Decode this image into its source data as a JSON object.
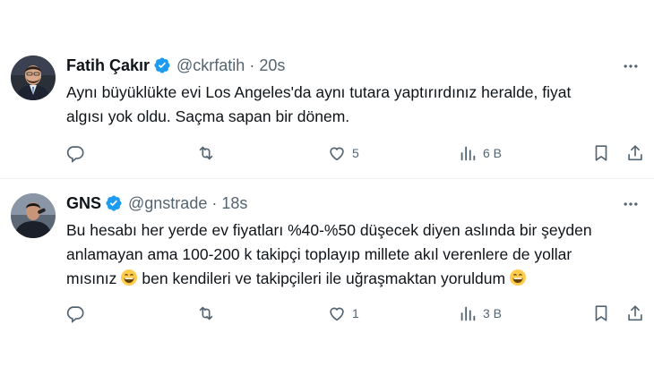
{
  "tweets": [
    {
      "name": "Fatih Çakır",
      "handle": "@ckrfatih",
      "separator": "·",
      "time": "20s",
      "text_lines": [
        "Aynı büyüklükte evi Los Angeles'da aynı tutara yaptırırdınız heralde, fiyat",
        "algısı yok oldu. Saçma sapan bir dönem."
      ],
      "replies": "",
      "retweets": "",
      "likes": "5",
      "views": "6 B"
    },
    {
      "name": "GNS",
      "handle": "@gnstrade",
      "separator": "·",
      "time": "18s",
      "text_lines": [
        "Bu hesabı her yerde ev fiyatları %40-%50 düşecek diyen aslında bir şeyden",
        "anlamayan ama 100-200 k takipçi toplayıp millete akıl verenlere de yollar"
      ],
      "text_line3_a": "mısınız",
      "text_line3_b": "ben kendileri ve takipçileri ile uğraşmaktan yoruldum",
      "replies": "",
      "retweets": "",
      "likes": "1",
      "views": "3 B"
    }
  ],
  "colors": {
    "text": "#0f1419",
    "secondary": "#536471",
    "verified": "#1d9bf0",
    "divider": "#eff3f4"
  },
  "icons": [
    "verified-badge-icon",
    "more-icon",
    "reply-icon",
    "retweet-icon",
    "like-icon",
    "views-icon",
    "bookmark-icon",
    "share-icon",
    "grinning-emoji"
  ]
}
